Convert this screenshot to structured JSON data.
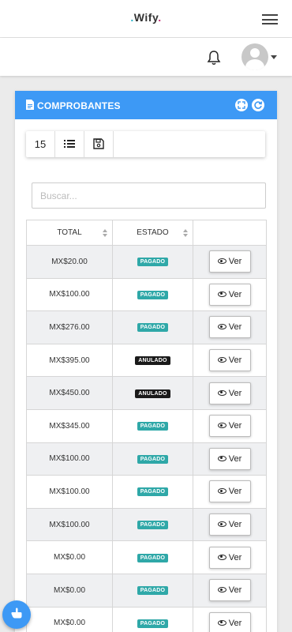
{
  "header": {
    "logo_text": "Wify",
    "menu_icon": "hamburger-icon",
    "bell_icon": "bell-icon",
    "avatar_icon": "user-avatar-icon"
  },
  "card": {
    "title": "COMPROBANTES",
    "title_icon": "document-icon",
    "fullscreen_icon": "expand-icon",
    "refresh_icon": "refresh-icon",
    "accent_color": "#3d99f5"
  },
  "toolbar": {
    "page_size": "15",
    "list_icon": "list-icon",
    "save_icon": "floppy-disk-icon"
  },
  "search": {
    "placeholder": "Buscar..."
  },
  "table": {
    "columns": [
      "TOTAL",
      "ESTADO",
      ""
    ],
    "action_label": "Ver",
    "rows": [
      {
        "total": "MX$20.00",
        "estado": "PAGADO"
      },
      {
        "total": "MX$100.00",
        "estado": "PAGADO"
      },
      {
        "total": "MX$276.00",
        "estado": "PAGADO"
      },
      {
        "total": "MX$395.00",
        "estado": "ANULADO"
      },
      {
        "total": "MX$450.00",
        "estado": "ANULADO"
      },
      {
        "total": "MX$345.00",
        "estado": "PAGADO"
      },
      {
        "total": "MX$100.00",
        "estado": "PAGADO"
      },
      {
        "total": "MX$100.00",
        "estado": "PAGADO"
      },
      {
        "total": "MX$100.00",
        "estado": "PAGADO"
      },
      {
        "total": "MX$0.00",
        "estado": "PAGADO"
      },
      {
        "total": "MX$0.00",
        "estado": "PAGADO"
      },
      {
        "total": "MX$0.00",
        "estado": "PAGADO"
      }
    ]
  },
  "status_colors": {
    "PAGADO": "#2fa8a8",
    "ANULADO": "#1a1a1a"
  },
  "floating_button_icon": "hand-pointer-icon"
}
